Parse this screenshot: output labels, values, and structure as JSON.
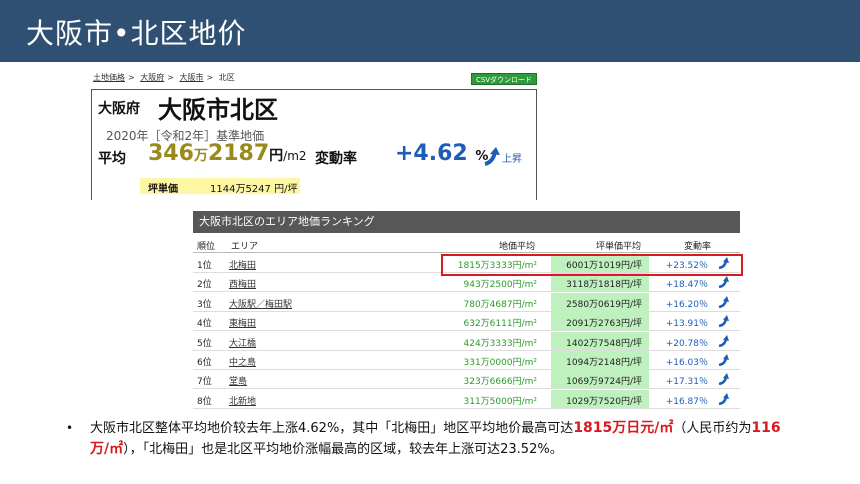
{
  "title": "大阪市•北区地价",
  "breadcrumb": [
    "土地価格",
    "大阪府",
    "大阪市",
    "北区"
  ],
  "csv_button": "CSVダウンロード",
  "summary": {
    "prefecture": "大阪府",
    "city": "大阪市北区",
    "year": "2020年［令和2年］基準地価",
    "avg_label": "平均",
    "avg_man": "346",
    "man": "万",
    "avg_rest": "2187",
    "yen": "円",
    "unit": "/m2",
    "change_label": "変動率",
    "change_value": "+4.62",
    "change_pct": "%",
    "up_text": "上昇",
    "tsubo_label": "坪単価",
    "tsubo_value": "1144万5247 円/坪"
  },
  "ranking": {
    "title": "大阪市北区のエリア地価ランキング",
    "headers": {
      "rank": "順位",
      "area": "エリア",
      "land": "地価平均",
      "tsubo": "坪単価平均",
      "change": "変動率"
    },
    "rows": [
      {
        "rank": "1位",
        "area": "北梅田",
        "land": "1815万3333円/m²",
        "tsubo": "6001万1019円/坪",
        "change": "+23.52％"
      },
      {
        "rank": "2位",
        "area": "西梅田",
        "land": "943万2500円/m²",
        "tsubo": "3118万1818円/坪",
        "change": "+18.47％"
      },
      {
        "rank": "3位",
        "area": "大阪駅／梅田駅",
        "land": "780万4687円/m²",
        "tsubo": "2580万0619円/坪",
        "change": "+16.20％"
      },
      {
        "rank": "4位",
        "area": "東梅田",
        "land": "632万6111円/m²",
        "tsubo": "2091万2763円/坪",
        "change": "+13.91％"
      },
      {
        "rank": "5位",
        "area": "大江橋",
        "land": "424万3333円/m²",
        "tsubo": "1402万7548円/坪",
        "change": "+20.78％"
      },
      {
        "rank": "6位",
        "area": "中之島",
        "land": "331万0000円/m²",
        "tsubo": "1094万2148円/坪",
        "change": "+16.03％"
      },
      {
        "rank": "7位",
        "area": "堂島",
        "land": "323万6666円/m²",
        "tsubo": "1069万9724円/坪",
        "change": "+17.31％"
      },
      {
        "rank": "8位",
        "area": "北新地",
        "land": "311万5000円/m²",
        "tsubo": "1029万7520円/坪",
        "change": "+16.87％"
      }
    ]
  },
  "note": {
    "bullet": "•",
    "part1": "大阪市北区整体平均地价较去年上涨4.62%，其中「北梅田」地区平均地价最高可达",
    "red1": "1815万日元/㎡",
    "part2": "（人民币约为",
    "red2": "116万/㎡",
    "part3": "），「北梅田」也是北区平均地价涨幅最高的区域，较去年上涨可达23.52%。"
  },
  "colors": {
    "title_bar": "#2f5073",
    "highlight": "#d71920",
    "accent_blue": "#1f5cb8",
    "tsubo_bg": "#bff1bf"
  }
}
